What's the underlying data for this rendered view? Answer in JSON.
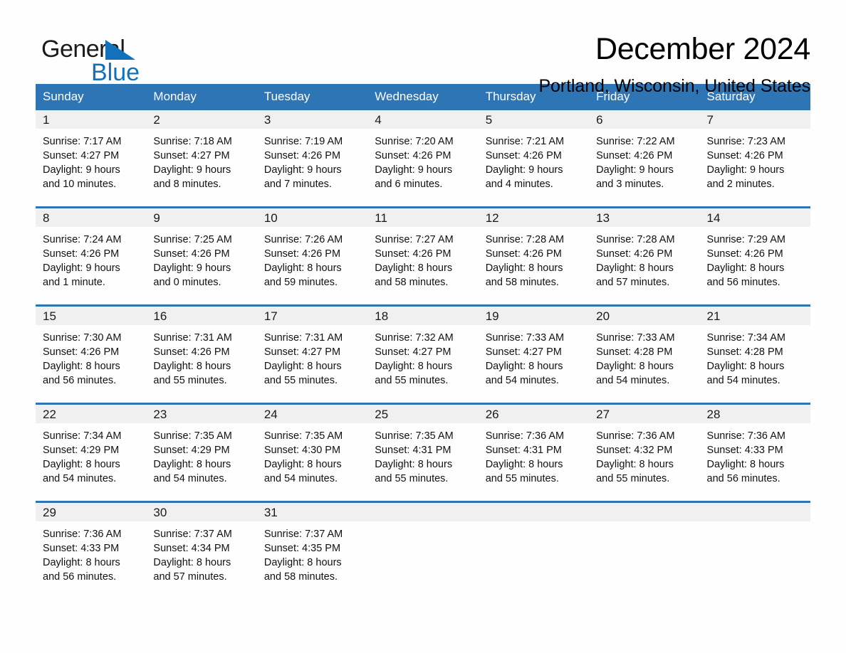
{
  "brand": {
    "name_part1": "General",
    "name_part2": "Blue",
    "logo_triangle": "triangle-icon",
    "accent_color": "#1171ba"
  },
  "header": {
    "title": "December 2024",
    "subtitle": "Portland, Wisconsin, United States"
  },
  "theme": {
    "header_blue": "#2e75b6",
    "day_band_gray": "#f0f0f0",
    "page_background": "#fefefe",
    "text_color": "#000000"
  },
  "calendar": {
    "weekday_headers": [
      "Sunday",
      "Monday",
      "Tuesday",
      "Wednesday",
      "Thursday",
      "Friday",
      "Saturday"
    ],
    "weeks": [
      [
        {
          "day": "1",
          "info": "Sunrise: 7:17 AM\nSunset: 4:27 PM\nDaylight: 9 hours\nand 10 minutes."
        },
        {
          "day": "2",
          "info": "Sunrise: 7:18 AM\nSunset: 4:27 PM\nDaylight: 9 hours\nand 8 minutes."
        },
        {
          "day": "3",
          "info": "Sunrise: 7:19 AM\nSunset: 4:26 PM\nDaylight: 9 hours\nand 7 minutes."
        },
        {
          "day": "4",
          "info": "Sunrise: 7:20 AM\nSunset: 4:26 PM\nDaylight: 9 hours\nand 6 minutes."
        },
        {
          "day": "5",
          "info": "Sunrise: 7:21 AM\nSunset: 4:26 PM\nDaylight: 9 hours\nand 4 minutes."
        },
        {
          "day": "6",
          "info": "Sunrise: 7:22 AM\nSunset: 4:26 PM\nDaylight: 9 hours\nand 3 minutes."
        },
        {
          "day": "7",
          "info": "Sunrise: 7:23 AM\nSunset: 4:26 PM\nDaylight: 9 hours\nand 2 minutes."
        }
      ],
      [
        {
          "day": "8",
          "info": "Sunrise: 7:24 AM\nSunset: 4:26 PM\nDaylight: 9 hours\nand 1 minute."
        },
        {
          "day": "9",
          "info": "Sunrise: 7:25 AM\nSunset: 4:26 PM\nDaylight: 9 hours\nand 0 minutes."
        },
        {
          "day": "10",
          "info": "Sunrise: 7:26 AM\nSunset: 4:26 PM\nDaylight: 8 hours\nand 59 minutes."
        },
        {
          "day": "11",
          "info": "Sunrise: 7:27 AM\nSunset: 4:26 PM\nDaylight: 8 hours\nand 58 minutes."
        },
        {
          "day": "12",
          "info": "Sunrise: 7:28 AM\nSunset: 4:26 PM\nDaylight: 8 hours\nand 58 minutes."
        },
        {
          "day": "13",
          "info": "Sunrise: 7:28 AM\nSunset: 4:26 PM\nDaylight: 8 hours\nand 57 minutes."
        },
        {
          "day": "14",
          "info": "Sunrise: 7:29 AM\nSunset: 4:26 PM\nDaylight: 8 hours\nand 56 minutes."
        }
      ],
      [
        {
          "day": "15",
          "info": "Sunrise: 7:30 AM\nSunset: 4:26 PM\nDaylight: 8 hours\nand 56 minutes."
        },
        {
          "day": "16",
          "info": "Sunrise: 7:31 AM\nSunset: 4:26 PM\nDaylight: 8 hours\nand 55 minutes."
        },
        {
          "day": "17",
          "info": "Sunrise: 7:31 AM\nSunset: 4:27 PM\nDaylight: 8 hours\nand 55 minutes."
        },
        {
          "day": "18",
          "info": "Sunrise: 7:32 AM\nSunset: 4:27 PM\nDaylight: 8 hours\nand 55 minutes."
        },
        {
          "day": "19",
          "info": "Sunrise: 7:33 AM\nSunset: 4:27 PM\nDaylight: 8 hours\nand 54 minutes."
        },
        {
          "day": "20",
          "info": "Sunrise: 7:33 AM\nSunset: 4:28 PM\nDaylight: 8 hours\nand 54 minutes."
        },
        {
          "day": "21",
          "info": "Sunrise: 7:34 AM\nSunset: 4:28 PM\nDaylight: 8 hours\nand 54 minutes."
        }
      ],
      [
        {
          "day": "22",
          "info": "Sunrise: 7:34 AM\nSunset: 4:29 PM\nDaylight: 8 hours\nand 54 minutes."
        },
        {
          "day": "23",
          "info": "Sunrise: 7:35 AM\nSunset: 4:29 PM\nDaylight: 8 hours\nand 54 minutes."
        },
        {
          "day": "24",
          "info": "Sunrise: 7:35 AM\nSunset: 4:30 PM\nDaylight: 8 hours\nand 54 minutes."
        },
        {
          "day": "25",
          "info": "Sunrise: 7:35 AM\nSunset: 4:31 PM\nDaylight: 8 hours\nand 55 minutes."
        },
        {
          "day": "26",
          "info": "Sunrise: 7:36 AM\nSunset: 4:31 PM\nDaylight: 8 hours\nand 55 minutes."
        },
        {
          "day": "27",
          "info": "Sunrise: 7:36 AM\nSunset: 4:32 PM\nDaylight: 8 hours\nand 55 minutes."
        },
        {
          "day": "28",
          "info": "Sunrise: 7:36 AM\nSunset: 4:33 PM\nDaylight: 8 hours\nand 56 minutes."
        }
      ],
      [
        {
          "day": "29",
          "info": "Sunrise: 7:36 AM\nSunset: 4:33 PM\nDaylight: 8 hours\nand 56 minutes."
        },
        {
          "day": "30",
          "info": "Sunrise: 7:37 AM\nSunset: 4:34 PM\nDaylight: 8 hours\nand 57 minutes."
        },
        {
          "day": "31",
          "info": "Sunrise: 7:37 AM\nSunset: 4:35 PM\nDaylight: 8 hours\nand 58 minutes."
        },
        {
          "day": "",
          "info": ""
        },
        {
          "day": "",
          "info": ""
        },
        {
          "day": "",
          "info": ""
        },
        {
          "day": "",
          "info": ""
        }
      ]
    ]
  }
}
